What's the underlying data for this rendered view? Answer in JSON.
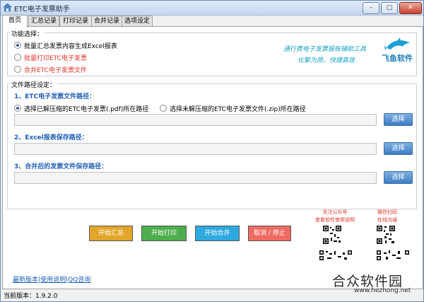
{
  "window": {
    "title": "ETC电子发票助手",
    "min_glyph": "–",
    "max_glyph": "▢",
    "close_glyph": "✕",
    "accent": "#3d7cc4",
    "red": "#e0342a"
  },
  "tabs": [
    "首页",
    "汇总记录",
    "打印记录",
    "合并记录",
    "选项设定"
  ],
  "function_group": {
    "legend": "功能选择：",
    "options": [
      {
        "label": "批量汇总发票内容生成Excel报表",
        "selected": true
      },
      {
        "label": "批量打印ETC电子发票",
        "selected": false
      },
      {
        "label": "合并ETC电子发票文件",
        "selected": false
      }
    ],
    "slogan_line1": "通行费电子发票报账辅助工具",
    "slogan_line2": "化繁为简、快捷高效",
    "logo_text": "飞鱼软件",
    "logo_icon": "dolphin-logo"
  },
  "path_group": {
    "legend": "文件路径设定：",
    "section1_title": "1、ETC电子发票文件路径：",
    "source_options": [
      {
        "label": "选择已解压缩的ETC电子发票(.pdf)所在路径",
        "selected": true
      },
      {
        "label": "选择未解压缩的ETC电子发票文件(.zip)所在路径",
        "selected": false
      }
    ],
    "section2_title": "2、Excel报表保存路径：",
    "section3_title": "3、合并后的发票文件保存路径：",
    "browse_label": "选择",
    "path1_value": "",
    "path2_value": "",
    "path3_value": ""
  },
  "actions": {
    "summary": {
      "label": "开始汇总",
      "color": "#e2a62b"
    },
    "print": {
      "label": "开始打印",
      "color": "#4cae4c"
    },
    "merge": {
      "label": "开始合并",
      "color": "#2ea9df"
    },
    "cancel": {
      "label": "取消 / 停止",
      "color": "#ef6b62"
    }
  },
  "qr": {
    "left_caption_1": "关注公众号",
    "left_caption_2": "查看软件使用说明",
    "right_caption_1": "微信扫码",
    "right_caption_2": "在线沟通"
  },
  "links": {
    "latest": "最新版本",
    "sep1": "|",
    "manual": "使用说明",
    "sep2": "|",
    "qq": "QQ咨询"
  },
  "status": {
    "version": "当前版本：1.9.2.0"
  },
  "watermark": {
    "text": "合众软件园",
    "url": "www.hezhong.net"
  }
}
